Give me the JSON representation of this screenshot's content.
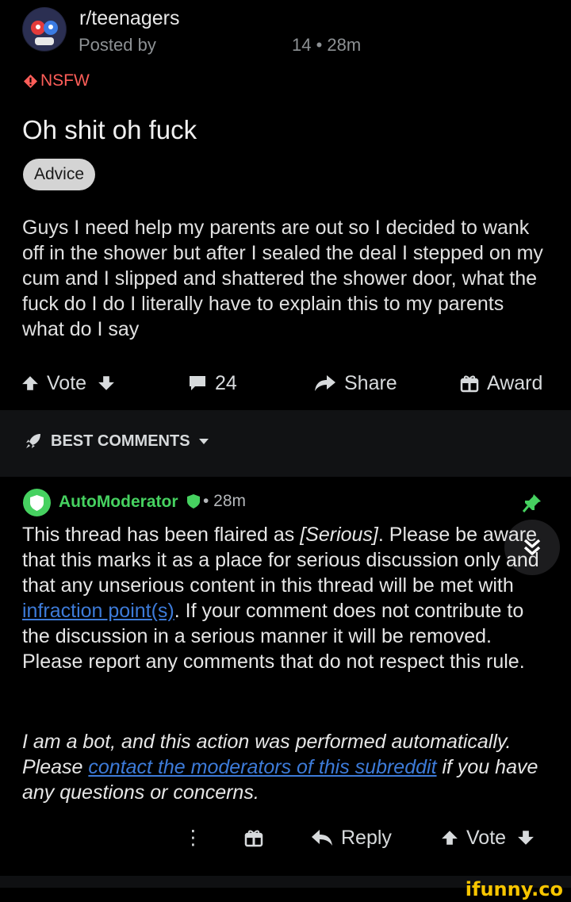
{
  "post": {
    "subreddit": "r/teenagers",
    "posted_by": "Posted by",
    "meta": "14 • 28m",
    "nsfw": "NSFW",
    "title": "Oh shit oh fuck",
    "flair": "Advice",
    "body": "Guys I need help my parents are out so I decided to wank off in the shower but after I sealed the deal I stepped on my cum and I slipped and shattered the shower door, what the fuck do I do I literally have to explain this to my parents what do I say",
    "actions": {
      "vote": "Vote",
      "comments": "24",
      "share": "Share",
      "award": "Award"
    }
  },
  "sort": {
    "label": "BEST COMMENTS"
  },
  "comment": {
    "author": "AutoModerator",
    "time": "• 28m",
    "text_before_link": "This thread has been flaired as ",
    "text_italic": "[Serious]",
    "text_mid": ". Please be aware that this marks it as a place for serious discussion only and that any unserious content in this thread will be met with ",
    "link_text": "infraction point(s)",
    "text_after_link": ". If your comment does not contribute to the discussion in a serious manner it will be removed. Please report any comments that do not respect this rule.",
    "bot_before": "I am a bot, and this action was performed automatically. Please ",
    "bot_link": "contact the moderators of this subreddit",
    "bot_after": " if you have any questions or concerns.",
    "actions": {
      "more": "⋮",
      "reply": "Reply",
      "vote": "Vote"
    }
  },
  "watermark": "ifunny.co",
  "colors": {
    "background": "#000000",
    "mod_green": "#46d160",
    "nsfw_red": "#ff5e59",
    "link_blue": "#3d7bd9",
    "watermark_yellow": "#f7c500"
  }
}
